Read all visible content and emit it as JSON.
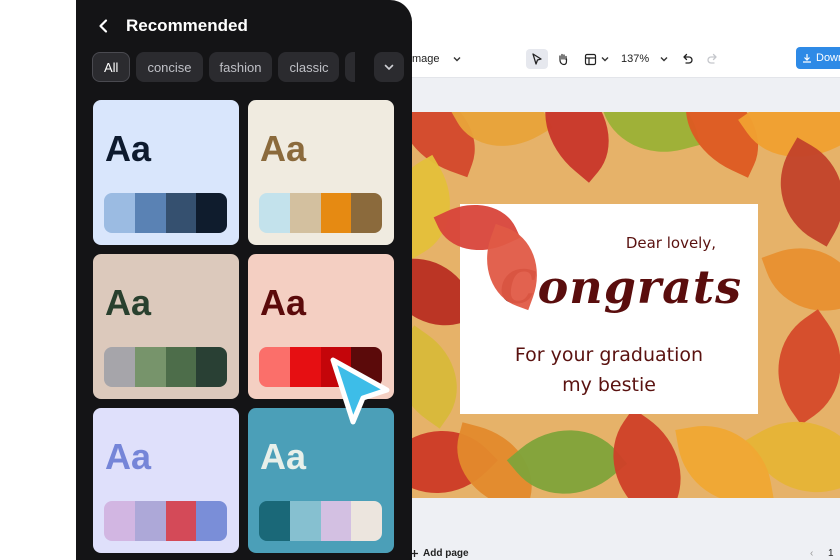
{
  "panel": {
    "title": "Recommended",
    "chips": [
      "All",
      "concise",
      "fashion",
      "classic"
    ],
    "selected_chip": "All",
    "themes": [
      {
        "sample": "Aa",
        "bg": "#d9e6fc",
        "text": "#0d1a2e",
        "swatches": [
          "#9bbbe2",
          "#5a82b4",
          "#35506f",
          "#0f1c2d"
        ]
      },
      {
        "sample": "Aa",
        "bg": "#f0ebe0",
        "text": "#8b6a3c",
        "swatches": [
          "#c3e2ec",
          "#d3c09f",
          "#e68a12",
          "#8b6a3c"
        ]
      },
      {
        "sample": "Aa",
        "bg": "#dcc9bc",
        "text": "#29402e",
        "swatches": [
          "#a6a5aa",
          "#77946b",
          "#4d6d4a",
          "#294034"
        ]
      },
      {
        "sample": "Aa",
        "bg": "#f4cfc2",
        "text": "#5b0a0a",
        "swatches": [
          "#fb6f6a",
          "#e60f12",
          "#c4050a",
          "#5b0a0a"
        ]
      },
      {
        "sample": "Aa",
        "bg": "#dfe0fb",
        "text": "#7585d8",
        "swatches": [
          "#d2b6e2",
          "#ada8d8",
          "#d44a58",
          "#7a8ed8"
        ]
      },
      {
        "sample": "Aa",
        "bg": "#4b9fb8",
        "text": "#e8f0ea",
        "swatches": [
          "#1a6878",
          "#86c0d0",
          "#d3c0e2",
          "#ece5de"
        ]
      }
    ]
  },
  "toolbar": {
    "mode_label": "mage",
    "zoom": "137%",
    "download_label": "Down"
  },
  "design": {
    "greeting": "Dear lovely,",
    "headline": "Congrats",
    "subline_1": "For your graduation",
    "subline_2": "my bestie"
  },
  "footer": {
    "add_page_label": "Add page",
    "page_indicator": "1"
  },
  "colors": {
    "panel_bg": "#141416",
    "accent": "#2e8ae6",
    "cursor": "#3dbde8"
  }
}
